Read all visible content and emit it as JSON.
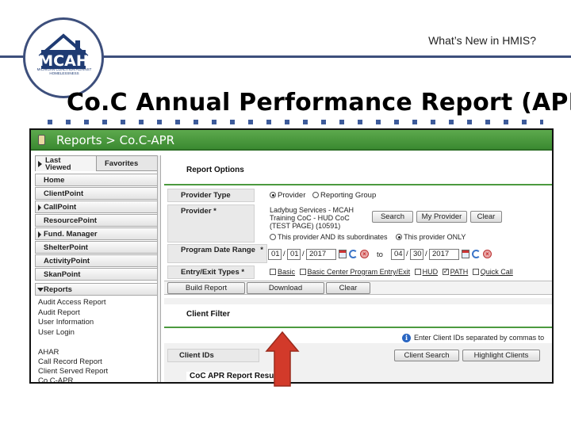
{
  "slide": {
    "subtitle": "What’s New in HMIS?",
    "title": "Co.C Annual Performance Report (APR)",
    "logo": {
      "mark": "MCAH",
      "caption": "MICHIGAN COALITION AGAINST HOMELESSNESS"
    }
  },
  "app": {
    "breadcrumb": "Reports > Co.C-APR",
    "nav": {
      "tabs": [
        "Last Viewed",
        "Favorites"
      ],
      "items": [
        "Home",
        "ClientPoint",
        "CallPoint",
        "ResourcePoint",
        "Fund. Manager",
        "ShelterPoint",
        "ActivityPoint",
        "SkanPoint",
        "Reports"
      ],
      "report_links": [
        "Audit Access Report",
        "Audit Report",
        "User Information",
        "User Login"
      ],
      "report_links_2": [
        "AHAR",
        "Call Record Report",
        "Client Served Report",
        "Co.C-APR"
      ]
    },
    "report_options": {
      "heading": "Report Options",
      "provider_type_label": "Provider Type",
      "provider_type_options": [
        "Provider",
        "Reporting Group"
      ],
      "provider_type_selected": "Provider",
      "provider_label": "Provider *",
      "provider_value": "Ladybug Services - MCAH Training CoC - HUD CoC (TEST PAGE) (10591)",
      "provider_buttons": [
        "Search",
        "My Provider",
        "Clear"
      ],
      "scope_options": [
        "This provider AND its subordinates",
        "This provider ONLY"
      ],
      "scope_selected": "This provider ONLY",
      "date_label": "Program Date Range",
      "date_req": "*",
      "start_date": [
        "01",
        "01",
        "2017"
      ],
      "date_to": "to",
      "end_date": [
        "04",
        "30",
        "2017"
      ],
      "entry_exit_label": "Entry/Exit Types *",
      "entry_exit_options": [
        "Basic",
        "Basic Center Program Entry/Exit",
        "HUD",
        "PATH",
        "Quick Call"
      ],
      "entry_exit_checked": [
        "PATH"
      ],
      "action_buttons": [
        "Build Report",
        "Download",
        "Clear"
      ]
    },
    "client_filter": {
      "heading": "Client Filter",
      "info_text": "Enter Client IDs separated by commas to",
      "client_ids_label": "Client IDs",
      "buttons": [
        "Client Search",
        "Highlight Clients"
      ]
    },
    "results": {
      "heading": "CoC APR Report Results"
    }
  },
  "colors": {
    "title_bar_green": "#4c9a3f",
    "slide_accent": "#3d4f7c",
    "arrow_red": "#d23a2a"
  }
}
